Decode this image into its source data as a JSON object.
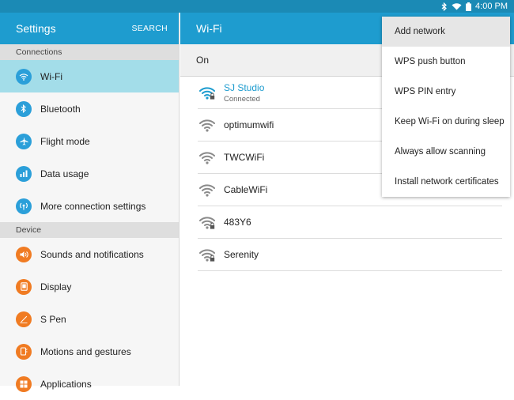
{
  "status_bar": {
    "time": "4:00 PM"
  },
  "settings": {
    "title": "Settings",
    "search_label": "SEARCH",
    "sections": [
      {
        "header": "Connections",
        "items": [
          {
            "label": "Wi-Fi",
            "icon": "wifi-icon",
            "active": true
          },
          {
            "label": "Bluetooth",
            "icon": "bluetooth-icon"
          },
          {
            "label": "Flight mode",
            "icon": "airplane-icon"
          },
          {
            "label": "Data usage",
            "icon": "data-usage-icon"
          },
          {
            "label": "More connection settings",
            "icon": "more-connection-icon"
          }
        ]
      },
      {
        "header": "Device",
        "items": [
          {
            "label": "Sounds and notifications",
            "icon": "speaker-icon"
          },
          {
            "label": "Display",
            "icon": "display-icon"
          },
          {
            "label": "S Pen",
            "icon": "pen-icon"
          },
          {
            "label": "Motions and gestures",
            "icon": "gesture-icon"
          },
          {
            "label": "Applications",
            "icon": "apps-icon"
          }
        ]
      }
    ]
  },
  "wifi": {
    "title": "Wi-Fi",
    "toggle_label": "On",
    "networks": [
      {
        "name": "SJ Studio",
        "status": "Connected",
        "secured": true
      },
      {
        "name": "optimumwifi",
        "secured": false
      },
      {
        "name": "TWCWiFi",
        "secured": false
      },
      {
        "name": "CableWiFi",
        "secured": false
      },
      {
        "name": "483Y6",
        "secured": true
      },
      {
        "name": "Serenity",
        "secured": true
      }
    ]
  },
  "menu": {
    "items": [
      "Add network",
      "WPS push button",
      "WPS PIN entry",
      "Keep Wi-Fi on during sleep",
      "Always allow scanning",
      "Install network certificates"
    ]
  },
  "colors": {
    "accent": "#1e9ccf",
    "status_bar": "#1b8ab5",
    "active_row": "#a3dde9",
    "icon_blue": "#2b9fd9",
    "icon_orange": "#f07b22"
  }
}
